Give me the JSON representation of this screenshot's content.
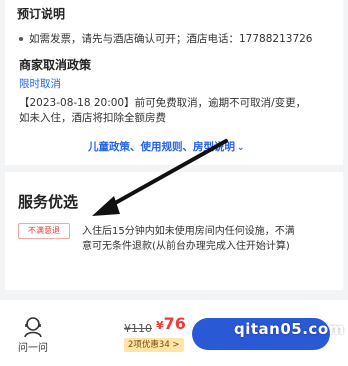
{
  "booking": {
    "title": "预订说明",
    "note": "如需发票，请先与酒店确认可开；酒店电话：17788213726"
  },
  "cancel": {
    "title": "商家取消政策",
    "type": "限时取消",
    "desc_line1": "【2023-08-18 20:00】前可免费取消，逾期不可取消/变更，",
    "desc_line2": "如未入住，酒店将扣除全额房费"
  },
  "policy_link": "儿童政策、使用规则、房型说明",
  "service": {
    "title": "服务优选",
    "tag": "不满意退",
    "desc_line1": "入住后15分钟内如未使用房间内任何设施，不满",
    "desc_line2": "意可无条件退款(从前台办理完成入住开始计算)"
  },
  "bottom": {
    "ask_label": "问一问",
    "original_price": "¥110",
    "price_symbol": "¥",
    "price": "76",
    "discount": "2项优惠34 >",
    "watermark": "qitan05.com"
  },
  "colors": {
    "accent_blue": "#2563eb",
    "price_red": "#ef3b3b",
    "button_blue": "#2a59d6"
  }
}
